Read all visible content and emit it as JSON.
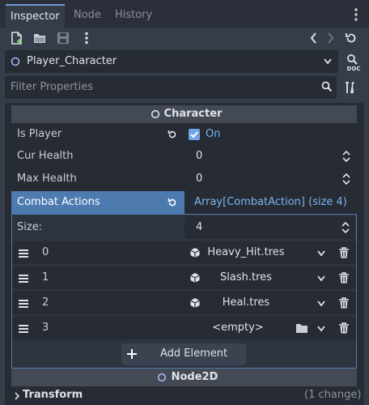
{
  "tabs": [
    {
      "label": "Inspector",
      "active": true
    },
    {
      "label": "Node",
      "active": false
    },
    {
      "label": "History",
      "active": false
    }
  ],
  "toolbar": {
    "icons": [
      "new-resource-icon",
      "open-folder-icon",
      "save-icon",
      "more-vertical-icon",
      "history-back-icon",
      "history-forward-icon",
      "object-history-icon"
    ]
  },
  "object_selector": {
    "name": "Player_Character",
    "doc_label": "DOC"
  },
  "filter": {
    "placeholder": "Filter Properties"
  },
  "sections": {
    "character": "Character",
    "node2d": "Node2D"
  },
  "properties": {
    "is_player": {
      "label": "Is Player",
      "value": "On",
      "checked": true
    },
    "cur_health": {
      "label": "Cur Health",
      "value": "0"
    },
    "max_health": {
      "label": "Max Health",
      "value": "0"
    }
  },
  "combat_actions": {
    "label": "Combat Actions",
    "summary": "Array[CombatAction] (size 4)",
    "size_label": "Size:",
    "size_value": "4",
    "elements": [
      {
        "index": "0",
        "value": "Heavy_Hit.tres"
      },
      {
        "index": "1",
        "value": "Slash.tres"
      },
      {
        "index": "2",
        "value": "Heal.tres"
      },
      {
        "index": "3",
        "value": "<empty>"
      }
    ],
    "add_label": "Add Element"
  },
  "transform": {
    "label": "Transform",
    "changes": "(1 change)"
  },
  "colors": {
    "accent": "#4d7bb0",
    "link": "#7bb5f0",
    "panel": "#262b34",
    "background": "#363d4a"
  }
}
